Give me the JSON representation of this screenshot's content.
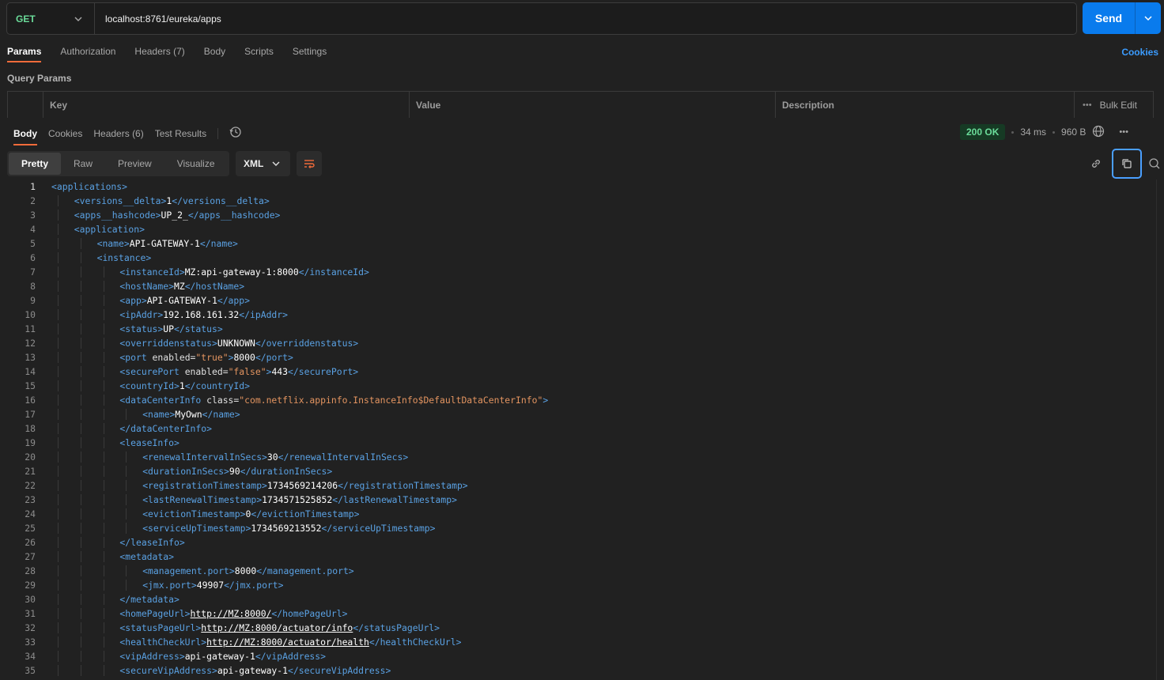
{
  "request": {
    "method": "GET",
    "url": "localhost:8761/eureka/apps",
    "send_label": "Send"
  },
  "request_tabs": [
    {
      "label": "Params",
      "active": true
    },
    {
      "label": "Authorization"
    },
    {
      "label": "Headers",
      "count": "(7)"
    },
    {
      "label": "Body"
    },
    {
      "label": "Scripts"
    },
    {
      "label": "Settings"
    }
  ],
  "cookies_label": "Cookies",
  "query_params": {
    "title": "Query Params",
    "columns": [
      "Key",
      "Value",
      "Description"
    ],
    "bulk_edit": "Bulk Edit"
  },
  "response_tabs": [
    {
      "label": "Body",
      "active": true
    },
    {
      "label": "Cookies"
    },
    {
      "label": "Headers",
      "count": "(6)"
    },
    {
      "label": "Test Results"
    }
  ],
  "response_status": {
    "status": "200 OK",
    "time": "34 ms",
    "size": "960 B"
  },
  "view_tabs": [
    "Pretty",
    "Raw",
    "Preview",
    "Visualize"
  ],
  "format": "XML",
  "colors": {
    "accent": "#f26b3a",
    "send": "#097bed",
    "tag": "#5aa1e3",
    "string": "#e39460",
    "status_ok": "#6bdd9a"
  },
  "icons": [
    "chevron-down-icon",
    "history-icon",
    "globe-icon",
    "more-icon",
    "wrap-lines-icon",
    "link-icon",
    "copy-icon",
    "search-icon"
  ],
  "code_lines": [
    {
      "n": 1,
      "i": 0,
      "p": [
        [
          "t",
          "<applications>"
        ]
      ]
    },
    {
      "n": 2,
      "i": 1,
      "p": [
        [
          "t",
          "<versions__delta>"
        ],
        [
          "v",
          "1"
        ],
        [
          "t",
          "</versions__delta>"
        ]
      ]
    },
    {
      "n": 3,
      "i": 1,
      "p": [
        [
          "t",
          "<apps__hashcode>"
        ],
        [
          "v",
          "UP_2_"
        ],
        [
          "t",
          "</apps__hashcode>"
        ]
      ]
    },
    {
      "n": 4,
      "i": 1,
      "p": [
        [
          "t",
          "<application>"
        ]
      ]
    },
    {
      "n": 5,
      "i": 2,
      "p": [
        [
          "t",
          "<name>"
        ],
        [
          "v",
          "API-GATEWAY-1"
        ],
        [
          "t",
          "</name>"
        ]
      ]
    },
    {
      "n": 6,
      "i": 2,
      "p": [
        [
          "t",
          "<instance>"
        ]
      ]
    },
    {
      "n": 7,
      "i": 3,
      "p": [
        [
          "t",
          "<instanceId>"
        ],
        [
          "v",
          "MZ:api-gateway-1:8000"
        ],
        [
          "t",
          "</instanceId>"
        ]
      ]
    },
    {
      "n": 8,
      "i": 3,
      "p": [
        [
          "t",
          "<hostName>"
        ],
        [
          "v",
          "MZ"
        ],
        [
          "t",
          "</hostName>"
        ]
      ]
    },
    {
      "n": 9,
      "i": 3,
      "p": [
        [
          "t",
          "<app>"
        ],
        [
          "v",
          "API-GATEWAY-1"
        ],
        [
          "t",
          "</app>"
        ]
      ]
    },
    {
      "n": 10,
      "i": 3,
      "p": [
        [
          "t",
          "<ipAddr>"
        ],
        [
          "v",
          "192.168.161.32"
        ],
        [
          "t",
          "</ipAddr>"
        ]
      ]
    },
    {
      "n": 11,
      "i": 3,
      "p": [
        [
          "t",
          "<status>"
        ],
        [
          "v",
          "UP"
        ],
        [
          "t",
          "</status>"
        ]
      ]
    },
    {
      "n": 12,
      "i": 3,
      "p": [
        [
          "t",
          "<overriddenstatus>"
        ],
        [
          "v",
          "UNKNOWN"
        ],
        [
          "t",
          "</overriddenstatus>"
        ]
      ]
    },
    {
      "n": 13,
      "i": 3,
      "p": [
        [
          "t",
          "<port "
        ],
        [
          "a",
          "enabled="
        ],
        [
          "s",
          "\"true\""
        ],
        [
          "t",
          ">"
        ],
        [
          "v",
          "8000"
        ],
        [
          "t",
          "</port>"
        ]
      ]
    },
    {
      "n": 14,
      "i": 3,
      "p": [
        [
          "t",
          "<securePort "
        ],
        [
          "a",
          "enabled="
        ],
        [
          "s",
          "\"false\""
        ],
        [
          "t",
          ">"
        ],
        [
          "v",
          "443"
        ],
        [
          "t",
          "</securePort>"
        ]
      ]
    },
    {
      "n": 15,
      "i": 3,
      "p": [
        [
          "t",
          "<countryId>"
        ],
        [
          "v",
          "1"
        ],
        [
          "t",
          "</countryId>"
        ]
      ]
    },
    {
      "n": 16,
      "i": 3,
      "p": [
        [
          "t",
          "<dataCenterInfo "
        ],
        [
          "a",
          "class="
        ],
        [
          "s",
          "\"com.netflix.appinfo.InstanceInfo$DefaultDataCenterInfo\""
        ],
        [
          "t",
          ">"
        ]
      ]
    },
    {
      "n": 17,
      "i": 4,
      "p": [
        [
          "t",
          "<name>"
        ],
        [
          "v",
          "MyOwn"
        ],
        [
          "t",
          "</name>"
        ]
      ]
    },
    {
      "n": 18,
      "i": 3,
      "p": [
        [
          "t",
          "</dataCenterInfo>"
        ]
      ]
    },
    {
      "n": 19,
      "i": 3,
      "p": [
        [
          "t",
          "<leaseInfo>"
        ]
      ]
    },
    {
      "n": 20,
      "i": 4,
      "p": [
        [
          "t",
          "<renewalIntervalInSecs>"
        ],
        [
          "v",
          "30"
        ],
        [
          "t",
          "</renewalIntervalInSecs>"
        ]
      ]
    },
    {
      "n": 21,
      "i": 4,
      "p": [
        [
          "t",
          "<durationInSecs>"
        ],
        [
          "v",
          "90"
        ],
        [
          "t",
          "</durationInSecs>"
        ]
      ]
    },
    {
      "n": 22,
      "i": 4,
      "p": [
        [
          "t",
          "<registrationTimestamp>"
        ],
        [
          "v",
          "1734569214206"
        ],
        [
          "t",
          "</registrationTimestamp>"
        ]
      ]
    },
    {
      "n": 23,
      "i": 4,
      "p": [
        [
          "t",
          "<lastRenewalTimestamp>"
        ],
        [
          "v",
          "1734571525852"
        ],
        [
          "t",
          "</lastRenewalTimestamp>"
        ]
      ]
    },
    {
      "n": 24,
      "i": 4,
      "p": [
        [
          "t",
          "<evictionTimestamp>"
        ],
        [
          "v",
          "0"
        ],
        [
          "t",
          "</evictionTimestamp>"
        ]
      ]
    },
    {
      "n": 25,
      "i": 4,
      "p": [
        [
          "t",
          "<serviceUpTimestamp>"
        ],
        [
          "v",
          "1734569213552"
        ],
        [
          "t",
          "</serviceUpTimestamp>"
        ]
      ]
    },
    {
      "n": 26,
      "i": 3,
      "p": [
        [
          "t",
          "</leaseInfo>"
        ]
      ]
    },
    {
      "n": 27,
      "i": 3,
      "p": [
        [
          "t",
          "<metadata>"
        ]
      ]
    },
    {
      "n": 28,
      "i": 4,
      "p": [
        [
          "t",
          "<management.port>"
        ],
        [
          "v",
          "8000"
        ],
        [
          "t",
          "</management.port>"
        ]
      ]
    },
    {
      "n": 29,
      "i": 4,
      "p": [
        [
          "t",
          "<jmx.port>"
        ],
        [
          "v",
          "49907"
        ],
        [
          "t",
          "</jmx.port>"
        ]
      ]
    },
    {
      "n": 30,
      "i": 3,
      "p": [
        [
          "t",
          "</metadata>"
        ]
      ]
    },
    {
      "n": 31,
      "i": 3,
      "p": [
        [
          "t",
          "<homePageUrl>"
        ],
        [
          "u",
          "http://MZ:8000/"
        ],
        [
          "t",
          "</homePageUrl>"
        ]
      ]
    },
    {
      "n": 32,
      "i": 3,
      "p": [
        [
          "t",
          "<statusPageUrl>"
        ],
        [
          "u",
          "http://MZ:8000/actuator/info"
        ],
        [
          "t",
          "</statusPageUrl>"
        ]
      ]
    },
    {
      "n": 33,
      "i": 3,
      "p": [
        [
          "t",
          "<healthCheckUrl>"
        ],
        [
          "u",
          "http://MZ:8000/actuator/health"
        ],
        [
          "t",
          "</healthCheckUrl>"
        ]
      ]
    },
    {
      "n": 34,
      "i": 3,
      "p": [
        [
          "t",
          "<vipAddress>"
        ],
        [
          "v",
          "api-gateway-1"
        ],
        [
          "t",
          "</vipAddress>"
        ]
      ]
    },
    {
      "n": 35,
      "i": 3,
      "p": [
        [
          "t",
          "<secureVipAddress>"
        ],
        [
          "v",
          "api-gateway-1"
        ],
        [
          "t",
          "</secureVipAddress>"
        ]
      ]
    }
  ]
}
